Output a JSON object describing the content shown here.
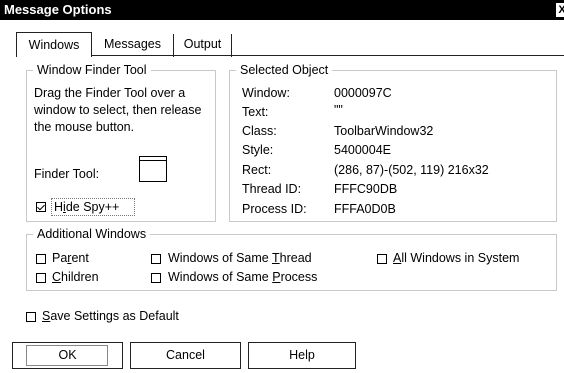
{
  "window": {
    "title": "Message Options",
    "close_glyph": "X"
  },
  "tabs": [
    "Windows",
    "Messages",
    "Output"
  ],
  "finder_group": {
    "title": "Window Finder Tool",
    "instructions": [
      "Drag the Finder Tool over a",
      "window to select, then release",
      "the mouse button."
    ],
    "finder_label": "Finder Tool:",
    "hide_spy": {
      "label_pre": "H",
      "label_u": "i",
      "label_post": "de Spy++",
      "checked": true
    }
  },
  "selected_object": {
    "title": "Selected Object",
    "rows": [
      {
        "label": "Window:",
        "value": "0000097C"
      },
      {
        "label": "Text:",
        "value": "\"\""
      },
      {
        "label": "Class:",
        "value": "ToolbarWindow32"
      },
      {
        "label": "Style:",
        "value": "5400004E"
      },
      {
        "label": "Rect:",
        "value": "(286, 87)-(502, 119) 216x32"
      },
      {
        "label": "Thread ID:",
        "value": "FFFC90DB"
      },
      {
        "label": "Process ID:",
        "value": "FFFA0D0B"
      }
    ]
  },
  "additional_windows": {
    "title": "Additional Windows",
    "options": {
      "parent": {
        "pre": "Pa",
        "u": "r",
        "post": "ent",
        "checked": false
      },
      "children": {
        "pre": "",
        "u": "C",
        "post": "hildren",
        "checked": false
      },
      "same_thread": {
        "pre": "Windows of Same ",
        "u": "T",
        "post": "hread",
        "checked": false
      },
      "same_process": {
        "pre": "Windows of Same ",
        "u": "P",
        "post": "rocess",
        "checked": false
      },
      "all_windows": {
        "pre": "",
        "u": "A",
        "post": "ll Windows in System",
        "checked": false
      }
    }
  },
  "save_settings": {
    "pre": "",
    "u": "S",
    "post": "ave Settings as Default",
    "checked": false
  },
  "buttons": {
    "ok": "OK",
    "cancel": "Cancel",
    "help": "Help"
  }
}
